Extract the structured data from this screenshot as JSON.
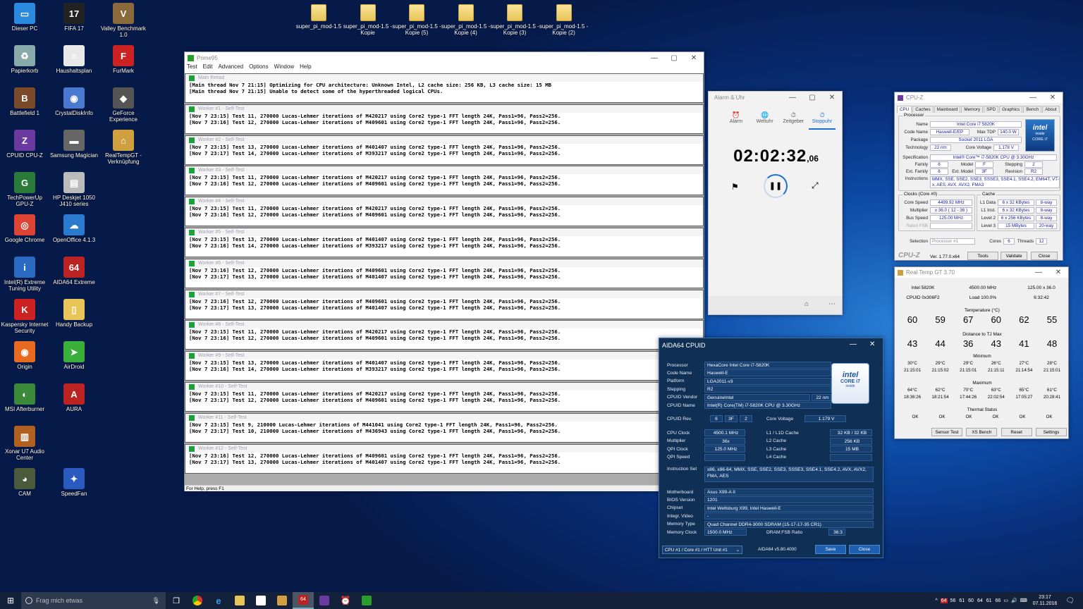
{
  "desktop": {
    "icons": [
      {
        "label": "Dieser PC",
        "glyph": "▭",
        "color": "#2a8ae0"
      },
      {
        "label": "FIFA 17",
        "glyph": "17",
        "color": "#222"
      },
      {
        "label": "Valley Benchmark 1.0",
        "glyph": "V",
        "color": "#8a6a3a"
      },
      {
        "label": "Papierkorb",
        "glyph": "♻",
        "color": "#8aa"
      },
      {
        "label": "Haushaltsplan",
        "glyph": "≡",
        "color": "#e8e8e8"
      },
      {
        "label": "FurMark",
        "glyph": "F",
        "color": "#c22"
      },
      {
        "label": "Battlefield 1",
        "glyph": "B",
        "color": "#7a4a2a"
      },
      {
        "label": "CrystalDiskInfo",
        "glyph": "◉",
        "color": "#4a7ad0"
      },
      {
        "label": "GeForce Experience",
        "glyph": "◆",
        "color": "#555"
      },
      {
        "label": "CPUID CPU-Z",
        "glyph": "Z",
        "color": "#6a3aa0"
      },
      {
        "label": "Samsung Magician",
        "glyph": "▬",
        "color": "#666"
      },
      {
        "label": "RealTempGT - Verknüpfung",
        "glyph": "⌂",
        "color": "#d0a040"
      },
      {
        "label": "TechPowerUp GPU-Z",
        "glyph": "G",
        "color": "#2a7a3a"
      },
      {
        "label": "HP Deskjet 1050 J410 series",
        "glyph": "▤",
        "color": "#bbb"
      },
      {
        "label": "Google Chrome",
        "glyph": "◎",
        "color": "#dd4433"
      },
      {
        "label": "OpenOffice 4.1.3",
        "glyph": "☁",
        "color": "#2a7ad0"
      },
      {
        "label": "Intel(R) Extreme Tuning Utility",
        "glyph": "i",
        "color": "#2a6ac0"
      },
      {
        "label": "AIDA64 Extreme",
        "glyph": "64",
        "color": "#b22"
      },
      {
        "label": "Kaspersky Internet Security",
        "glyph": "K",
        "color": "#c22"
      },
      {
        "label": "Handy Backup",
        "glyph": "▯",
        "color": "#e8c558"
      },
      {
        "label": "Origin",
        "glyph": "◉",
        "color": "#e86a20"
      },
      {
        "label": "AirDroid",
        "glyph": "➤",
        "color": "#3ab03a"
      },
      {
        "label": "MSI Afterburner",
        "glyph": "◐",
        "color": "#3a8a3a"
      },
      {
        "label": "AURA",
        "glyph": "A",
        "color": "#b22"
      },
      {
        "label": "Xonar U7 Audio Center",
        "glyph": "▥",
        "color": "#b06020"
      },
      {
        "label": "CAM",
        "glyph": "◕",
        "color": "#4a5a3a"
      },
      {
        "label": "SpeedFan",
        "glyph": "✦",
        "color": "#2a5ac0"
      }
    ],
    "folders": [
      "super_pi_mod-1.5",
      "super_pi_mod-1.5 - Kopie",
      "super_pi_mod-1.5 - Kopie (5)",
      "super_pi_mod-1.5 - Kopie (4)",
      "super_pi_mod-1.5 - Kopie (3)",
      "super_pi_mod-1.5 - Kopie (2)"
    ]
  },
  "prime95": {
    "title": "Prime95",
    "menu": [
      "Test",
      "Edit",
      "Advanced",
      "Options",
      "Window",
      "Help"
    ],
    "status": "For Help, press F1",
    "panes": [
      {
        "title": "Main thread",
        "lines": [
          "[Main thread Nov 7 21:15] Optimizing for CPU architecture: Unknown Intel, L2 cache size: 256 KB, L3 cache size: 15 MB",
          "[Main thread Nov 7 21:15] Unable to detect some of the hyperthreaded logical CPUs."
        ]
      },
      {
        "title": "Worker #1 - Self-Test",
        "lines": [
          "[Nov 7 23:15] Test 11, 270000 Lucas-Lehmer iterations of M420217 using Core2 type-1 FFT length 24K, Pass1=96, Pass2=256.",
          "[Nov 7 23:16] Test 12, 270000 Lucas-Lehmer iterations of M409601 using Core2 type-1 FFT length 24K, Pass1=96, Pass2=256."
        ]
      },
      {
        "title": "Worker #2 - Self-Test",
        "lines": [
          "[Nov 7 23:15] Test 13, 270000 Lucas-Lehmer iterations of M401407 using Core2 type-1 FFT length 24K, Pass1=96, Pass2=256.",
          "[Nov 7 23:17] Test 14, 270000 Lucas-Lehmer iterations of M393217 using Core2 type-1 FFT length 24K, Pass1=96, Pass2=256."
        ]
      },
      {
        "title": "Worker #3 - Self-Test",
        "lines": [
          "[Nov 7 23:15] Test 11, 270000 Lucas-Lehmer iterations of M420217 using Core2 type-1 FFT length 24K, Pass1=96, Pass2=256.",
          "[Nov 7 23:16] Test 12, 270000 Lucas-Lehmer iterations of M409601 using Core2 type-1 FFT length 24K, Pass1=96, Pass2=256."
        ]
      },
      {
        "title": "Worker #4 - Self-Test",
        "lines": [
          "[Nov 7 23:15] Test 11, 270000 Lucas-Lehmer iterations of M420217 using Core2 type-1 FFT length 24K, Pass1=96, Pass2=256.",
          "[Nov 7 23:16] Test 12, 270000 Lucas-Lehmer iterations of M409601 using Core2 type-1 FFT length 24K, Pass1=96, Pass2=256."
        ]
      },
      {
        "title": "Worker #5 - Self-Test",
        "lines": [
          "[Nov 7 23:15] Test 13, 270000 Lucas-Lehmer iterations of M401407 using Core2 type-1 FFT length 24K, Pass1=96, Pass2=256.",
          "[Nov 7 23:16] Test 14, 270000 Lucas-Lehmer iterations of M393217 using Core2 type-1 FFT length 24K, Pass1=96, Pass2=256."
        ]
      },
      {
        "title": "Worker #6 - Self-Test",
        "lines": [
          "[Nov 7 23:16] Test 12, 270000 Lucas-Lehmer iterations of M409601 using Core2 type-1 FFT length 24K, Pass1=96, Pass2=256.",
          "[Nov 7 23:17] Test 13, 270000 Lucas-Lehmer iterations of M401407 using Core2 type-1 FFT length 24K, Pass1=96, Pass2=256."
        ]
      },
      {
        "title": "Worker #7 - Self-Test",
        "lines": [
          "[Nov 7 23:16] Test 12, 270000 Lucas-Lehmer iterations of M409601 using Core2 type-1 FFT length 24K, Pass1=96, Pass2=256.",
          "[Nov 7 23:17] Test 13, 270000 Lucas-Lehmer iterations of M401407 using Core2 type-1 FFT length 24K, Pass1=96, Pass2=256."
        ]
      },
      {
        "title": "Worker #8 - Self-Test",
        "lines": [
          "[Nov 7 23:15] Test 11, 270000 Lucas-Lehmer iterations of M420217 using Core2 type-1 FFT length 24K, Pass1=96, Pass2=256.",
          "[Nov 7 23:16] Test 12, 270000 Lucas-Lehmer iterations of M409601 using Core2 type-1 FFT length 24K, Pass1=96, Pass2=256."
        ]
      },
      {
        "title": "Worker #9 - Self-Test",
        "lines": [
          "[Nov 7 23:15] Test 13, 270000 Lucas-Lehmer iterations of M401407 using Core2 type-1 FFT length 24K, Pass1=96, Pass2=256.",
          "[Nov 7 23:16] Test 14, 270000 Lucas-Lehmer iterations of M393217 using Core2 type-1 FFT length 24K, Pass1=96, Pass2=256."
        ]
      },
      {
        "title": "Worker #10 - Self-Test",
        "lines": [
          "[Nov 7 23:15] Test 11, 270000 Lucas-Lehmer iterations of M420217 using Core2 type-1 FFT length 24K, Pass1=96, Pass2=256.",
          "[Nov 7 23:17] Test 12, 270000 Lucas-Lehmer iterations of M409601 using Core2 type-1 FFT length 24K, Pass1=96, Pass2=256."
        ]
      },
      {
        "title": "Worker #11 - Self-Test",
        "lines": [
          "[Nov 7 23:15] Test 9, 210000 Lucas-Lehmer iterations of M441041 using Core2 type-1 FFT length 24K, Pass1=96, Pass2=256.",
          "[Nov 7 23:17] Test 10, 210000 Lucas-Lehmer iterations of M436943 using Core2 type-1 FFT length 24K, Pass1=96, Pass2=256."
        ]
      },
      {
        "title": "Worker #12 - Self-Test",
        "lines": [
          "[Nov 7 23:16] Test 12, 270000 Lucas-Lehmer iterations of M409601 using Core2 type-1 FFT length 24K, Pass1=96, Pass2=256.",
          "[Nov 7 23:17] Test 13, 270000 Lucas-Lehmer iterations of M401407 using Core2 type-1 FFT length 24K, Pass1=96, Pass2=256."
        ]
      }
    ]
  },
  "alarm": {
    "title": "Alarm & Uhr",
    "tabs": [
      "Alarm",
      "Weltuhr",
      "Zeitgeber",
      "Stoppuhr"
    ],
    "time": "02:02:32",
    "hundredths": ",06",
    "accent": "#1a6fd0"
  },
  "cpuz": {
    "title": "CPU-Z",
    "tabs": [
      "CPU",
      "Caches",
      "Mainboard",
      "Memory",
      "SPD",
      "Graphics",
      "Bench",
      "About"
    ],
    "processor_group": "Processor",
    "name_l": "Name",
    "name": "Intel Core i7 5820K",
    "code_l": "Code Name",
    "code": "Haswell-E/EP",
    "tdp_l": "Max TDP",
    "tdp": "140.0 W",
    "package_l": "Package",
    "package": "Socket 2011 LGA",
    "tech_l": "Technology",
    "tech": "22 nm",
    "cv_l": "Core Voltage",
    "cv": "1.178 V",
    "spec_l": "Specification",
    "spec": "Intel® Core™ i7-5820K CPU @ 3.30GHz",
    "family_l": "Family",
    "family": "6",
    "model_l": "Model",
    "model": "F",
    "stepping_l": "Stepping",
    "stepping": "2",
    "extfam_l": "Ext. Family",
    "extfam": "6",
    "extmod_l": "Ext. Model",
    "extmod": "3F",
    "rev_l": "Revision",
    "rev": "R2",
    "instr_l": "Instructions",
    "instr": "MMX, SSE, SSE2, SSE3, SSSE3, SSE4.1, SSE4.2, EM64T, VT-x, AES, AVX, AVX2, FMA3",
    "clocks_group": "Clocks (Core #0)",
    "cache_group": "Cache",
    "cs_l": "Core Speed",
    "cs": "4499.92 MHz",
    "mult_l": "Multiplier",
    "mult": "x 36.0 ( 12 - 36 )",
    "bus_l": "Bus Speed",
    "bus": "125.00 MHz",
    "fsb_l": "Rated FSB",
    "fsb": "",
    "l1d_l": "L1 Data",
    "l1d": "6 x 32 KBytes",
    "l1d_w": "8-way",
    "l1i_l": "L1 Inst.",
    "l1i": "6 x 32 KBytes",
    "l1i_w": "8-way",
    "l2_l": "Level 2",
    "l2": "6 x 256 KBytes",
    "l2_w": "8-way",
    "l3_l": "Level 3",
    "l3": "15 MBytes",
    "l3_w": "20-way",
    "sel_l": "Selection",
    "sel": "Processor #1",
    "cores_l": "Cores",
    "cores": "6",
    "threads_l": "Threads",
    "threads": "12",
    "brand": "CPU-Z",
    "ver": "Ver. 1.77.0.x64",
    "tools": "Tools",
    "validate": "Validate",
    "close": "Close",
    "intel_logo_text": "intel",
    "intel_inside": "inside",
    "intel_core": "CORE i7"
  },
  "realtemp": {
    "title": "Real Temp GT 3.70",
    "cpu": "Intel 5820K",
    "mhz": "4500.00 MHz",
    "bus": "125.00 x 36.0",
    "cpuid": "CPUID  0x306F2",
    "load": "Load 100.0%",
    "time": "6:32:42",
    "temp_title": "Temperature (°C)",
    "temps": [
      "60",
      "59",
      "67",
      "60",
      "62",
      "55"
    ],
    "dist_title": "Distance to TJ Max",
    "dists": [
      "43",
      "44",
      "36",
      "43",
      "41",
      "48"
    ],
    "min_title": "Minimum",
    "mins": [
      "30°C",
      "29°C",
      "29°C",
      "26°C",
      "27°C",
      "28°C"
    ],
    "min_times": [
      "21:15:01",
      "21:15:02",
      "21:15:01",
      "21:15:11",
      "21:14:54",
      "21:15:01"
    ],
    "max_title": "Maximum",
    "maxs": [
      "64°C",
      "62°C",
      "70°C",
      "63°C",
      "65°C",
      "61°C"
    ],
    "max_times": [
      "18:36:26",
      "18:21:54",
      "17:44:26",
      "22:02:54",
      "17:05:27",
      "20:28:41"
    ],
    "thermal_title": "Thermal Status",
    "status": [
      "OK",
      "OK",
      "OK",
      "OK",
      "OK",
      "OK"
    ],
    "buttons": [
      "Sensor Test",
      "XS Bench",
      "Reset",
      "Settings"
    ]
  },
  "aida": {
    "title": "AIDA64 CPUID",
    "rows1": [
      {
        "l": "Processor",
        "v": "HexaCore Intel Core i7-5820K"
      },
      {
        "l": "Code Name",
        "v": "Haswell-E"
      },
      {
        "l": "Platform",
        "v": "LGA2011-v3"
      },
      {
        "l": "Stepping",
        "v": "R2"
      },
      {
        "l": "CPUID Vendor",
        "v": "GenuineIntel",
        "x": "22 nm"
      },
      {
        "l": "CPUID Name",
        "v": "Intel(R) Core(TM) i7-5820K CPU @ 3.30GHz"
      }
    ],
    "rev_l": "CPUID Rev.",
    "rev": [
      "6",
      "3F",
      "2"
    ],
    "cv_l": "Core Voltage",
    "cv": "1.179 V",
    "clk": [
      {
        "l": "CPU Clock",
        "v": "4500.1 MHz",
        "l2": "L1 / L1D Cache",
        "v2": "32 KB / 32 KB"
      },
      {
        "l": "Multiplier",
        "v": "36x",
        "l2": "L2 Cache",
        "v2": "256 KB"
      },
      {
        "l": "QPI Clock",
        "v": "125.0 MHz",
        "l2": "L3 Cache",
        "v2": "15 MB"
      },
      {
        "l": "QPI Speed",
        "v": "",
        "l2": "L4 Cache",
        "v2": ""
      }
    ],
    "iset_l": "Instruction Set",
    "iset": "x86, x86-64, MMX, SSE, SSE2, SSE3, SSSE3, SSE4.1, SSE4.2, AVX, AVX2, FMA, AES",
    "rows2": [
      {
        "l": "Motherboard",
        "v": "Asus X99-A II"
      },
      {
        "l": "BIOS Version",
        "v": "1201"
      },
      {
        "l": "Chipset",
        "v": "Intel Wellsburg X99, Intel Haswell-E"
      },
      {
        "l": "Integr. Video",
        "v": "-"
      },
      {
        "l": "Memory Type",
        "v": "Quad Channel DDR4-3000 SDRAM  (15-17-17-35 CR1)"
      }
    ],
    "memclk_l": "Memory Clock",
    "memclk": "1500.0 MHz",
    "ratio_l": "DRAM:FSB Ratio",
    "ratio": "36:3",
    "select": "CPU #1 / Core #1 / HTT Unit #1",
    "version": "AIDA64 v5.80.4000",
    "save": "Save",
    "close": "Close"
  },
  "taskbar": {
    "search_placeholder": "Frag mich etwas",
    "tray_temps": [
      "56",
      "61",
      "60",
      "64",
      "61",
      "66"
    ],
    "tray_badge": "64",
    "clock_time": "23:17",
    "clock_date": "07.11.2016"
  }
}
